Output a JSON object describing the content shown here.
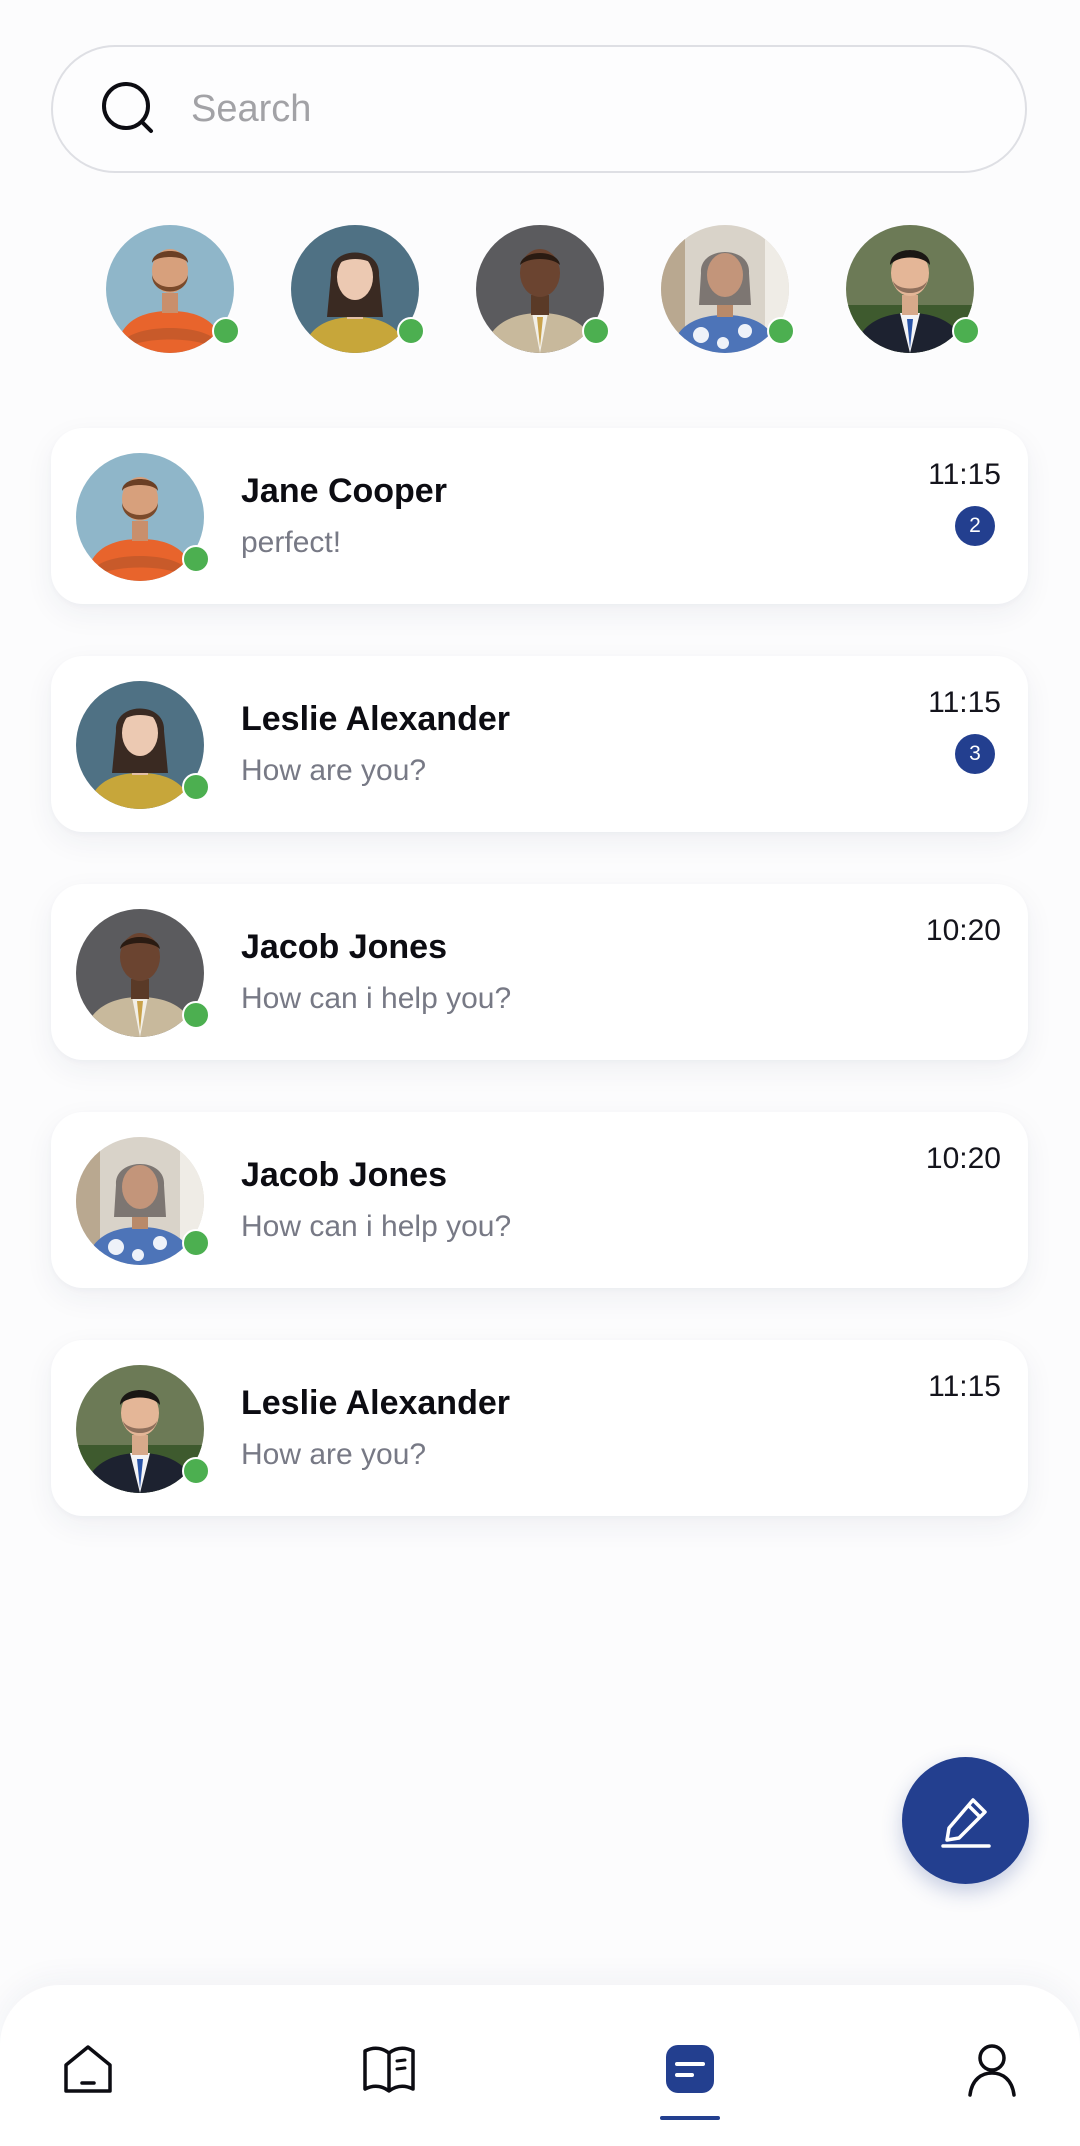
{
  "search": {
    "placeholder": "Search",
    "icon": "search-icon"
  },
  "stories": [
    {
      "avatar": "avatar-man-orange-shirt",
      "online": true
    },
    {
      "avatar": "avatar-woman-yellow-top",
      "online": true
    },
    {
      "avatar": "avatar-man-tan-suit",
      "online": true
    },
    {
      "avatar": "avatar-woman-blue-blouse",
      "online": true
    },
    {
      "avatar": "avatar-man-dark-suit",
      "online": true
    }
  ],
  "chats": [
    {
      "name": "Jane Cooper",
      "preview": "perfect!",
      "time": "11:15",
      "unread": "2",
      "online": true
    },
    {
      "name": "Leslie Alexander",
      "preview": "How are you?",
      "time": "11:15",
      "unread": "3",
      "online": true
    },
    {
      "name": "Jacob Jones",
      "preview": "How can i help you?",
      "time": "10:20",
      "unread": null,
      "online": true
    },
    {
      "name": "Jacob Jones",
      "preview": "How can i help you?",
      "time": "10:20",
      "unread": null,
      "online": true
    },
    {
      "name": "Leslie Alexander",
      "preview": "How are you?",
      "time": "11:15",
      "unread": null,
      "online": true
    }
  ],
  "fab": {
    "icon": "pencil-icon"
  },
  "bottom_nav": {
    "items": [
      {
        "icon": "home-icon",
        "active": false
      },
      {
        "icon": "book-icon",
        "active": false
      },
      {
        "icon": "chat-icon",
        "active": true
      },
      {
        "icon": "profile-icon",
        "active": false
      }
    ]
  },
  "colors": {
    "accent": "#233f8f",
    "online": "#4caf50",
    "preview_text": "#777985",
    "background": "#fcfcfd"
  }
}
